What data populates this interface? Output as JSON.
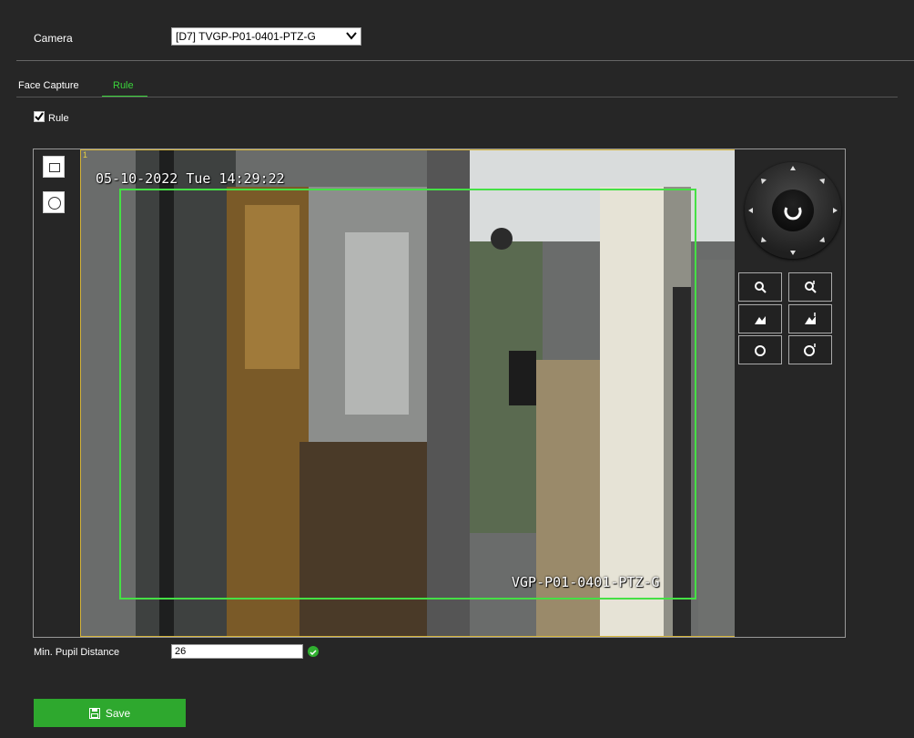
{
  "camera": {
    "label": "Camera",
    "selected": "[D7] TVGP-P01-0401-PTZ-G"
  },
  "tabs": [
    {
      "label": "Face Capture"
    },
    {
      "label": "Rule"
    }
  ],
  "rule_checkbox": {
    "label": "Rule",
    "checked": true
  },
  "video": {
    "osd_timestamp": "05-10-2022 Tue 14:29:22",
    "osd_camera_name": "VGP-P01-0401-PTZ-G",
    "corner_mark": "1"
  },
  "ptz": {
    "center_icon": "refresh-icon",
    "buttons": [
      "zoom-out-icon",
      "zoom-in-icon",
      "focus-near-icon",
      "focus-far-icon",
      "iris-close-icon",
      "iris-open-icon"
    ]
  },
  "pupil": {
    "label": "Min. Pupil Distance",
    "value": "26"
  },
  "save": {
    "label": "Save",
    "icon": "floppy-disk-icon"
  },
  "colors": {
    "accent": "#3bd43b",
    "roi": "#45e045",
    "background": "#262626"
  }
}
